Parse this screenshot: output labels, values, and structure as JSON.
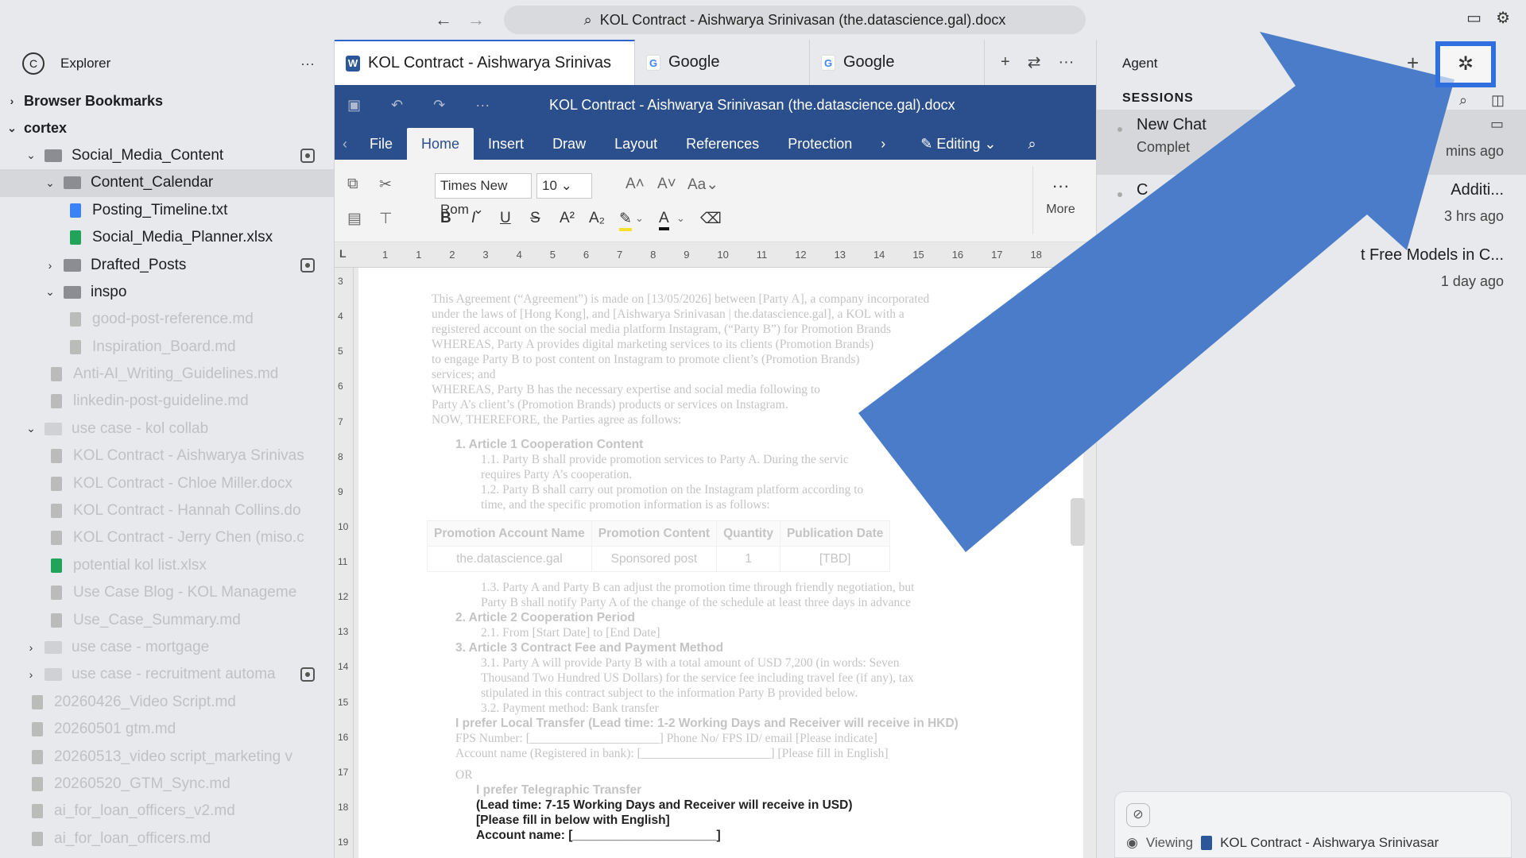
{
  "topbar": {
    "back": "←",
    "forward": "→",
    "url": "KOL Contract - Aishwarya Srinivasan (the.datascience.gal).docx",
    "icons": [
      "chat-plus-icon",
      "settings-icon"
    ]
  },
  "sidebar": {
    "title": "Explorer",
    "more": "···",
    "items": [
      {
        "label": "Browser Bookmarks",
        "level": 0,
        "chev": "›",
        "bold": true
      },
      {
        "label": "cortex",
        "level": 0,
        "chev": "⌄",
        "bold": true
      },
      {
        "label": "Social_Media_Content",
        "level": 1,
        "chev": "⌄",
        "folder": true,
        "badge": true
      },
      {
        "label": "Content_Calendar",
        "level": 2,
        "chev": "⌄",
        "folder": true,
        "selected": true
      },
      {
        "label": "Posting_Timeline.txt",
        "level": 3,
        "file": "txt"
      },
      {
        "label": "Social_Media_Planner.xlsx",
        "level": 3,
        "file": "xlsx"
      },
      {
        "label": "Drafted_Posts",
        "level": 2,
        "chev": "›",
        "folder": true,
        "badge": true
      },
      {
        "label": "inspo",
        "level": 2,
        "chev": "⌄",
        "folder": true
      },
      {
        "label": "good-post-reference.md",
        "level": 3,
        "file": "md",
        "faded": true
      },
      {
        "label": "Inspiration_Board.md",
        "level": 3,
        "file": "md",
        "faded": true
      },
      {
        "label": "Anti-AI_Writing_Guidelines.md",
        "level": 2,
        "file": "md",
        "faded": true
      },
      {
        "label": "linkedin-post-guideline.md",
        "level": 2,
        "file": "md",
        "faded": true
      },
      {
        "label": "use case - kol collab",
        "level": 1,
        "chev": "⌄",
        "folder": true,
        "faded": true
      },
      {
        "label": "KOL Contract - Aishwarya Srinivas",
        "level": 2,
        "file": "docx",
        "faded": true
      },
      {
        "label": "KOL Contract - Chloe Miller.docx",
        "level": 2,
        "file": "docx",
        "faded": true
      },
      {
        "label": "KOL Contract - Hannah Collins.do",
        "level": 2,
        "file": "docx",
        "faded": true
      },
      {
        "label": "KOL Contract - Jerry Chen (miso.c",
        "level": 2,
        "file": "docx",
        "faded": true
      },
      {
        "label": "potential kol list.xlsx",
        "level": 2,
        "file": "xlsx",
        "faded": true
      },
      {
        "label": "Use Case Blog - KOL Manageme",
        "level": 2,
        "file": "md",
        "faded": true
      },
      {
        "label": "Use_Case_Summary.md",
        "level": 2,
        "file": "md",
        "faded": true
      },
      {
        "label": "use case - mortgage",
        "level": 1,
        "chev": "›",
        "folder": true,
        "faded": true
      },
      {
        "label": "use case - recruitment automa",
        "level": 1,
        "chev": "›",
        "folder": true,
        "faded": true,
        "badge": true
      },
      {
        "label": "20260426_Video Script.md",
        "level": 1,
        "file": "md",
        "faded": true
      },
      {
        "label": "20260501 gtm.md",
        "level": 1,
        "file": "md",
        "faded": true
      },
      {
        "label": "20260513_video script_marketing v",
        "level": 1,
        "file": "md",
        "faded": true
      },
      {
        "label": "20260520_GTM_Sync.md",
        "level": 1,
        "file": "md",
        "faded": true
      },
      {
        "label": "ai_for_loan_officers_v2.md",
        "level": 1,
        "file": "md",
        "faded": true
      },
      {
        "label": "ai_for_loan_officers.md",
        "level": 1,
        "file": "md",
        "faded": true
      }
    ]
  },
  "editor": {
    "tabs": [
      {
        "label": "KOL Contract - Aishwarya Srinivas",
        "icon": "W",
        "active": true
      },
      {
        "label": "Google",
        "icon": "G"
      },
      {
        "label": "Google",
        "icon": "G"
      }
    ],
    "doc_title": "KOL Contract - Aishwarya Srinivasan (the.datascience.gal).docx",
    "ribbon_tabs": [
      "File",
      "Home",
      "Insert",
      "Draw",
      "Layout",
      "References",
      "Protection"
    ],
    "active_ribbon_tab": "Home",
    "editing_label": "Editing",
    "font_name": "Times New Rom",
    "font_size": "10",
    "more_label": "More",
    "ruler_h": [
      "1",
      "1",
      "2",
      "3",
      "4",
      "5",
      "6",
      "7",
      "8",
      "9",
      "10",
      "11",
      "12",
      "13",
      "14",
      "15",
      "16",
      "17",
      "18"
    ],
    "ruler_v": [
      "3",
      "4",
      "5",
      "6",
      "7",
      "8",
      "9",
      "10",
      "11",
      "12",
      "13",
      "14",
      "15",
      "16",
      "17",
      "18",
      "19"
    ],
    "doc": {
      "intro": [
        "This Agreement (“Agreement”) is made on [13/05/2026] between [Party A], a company incorporated",
        "under the laws of [Hong Kong], and [Aishwarya Srinivasan | the.datascience.gal], a KOL with a",
        "registered account on the social media platform Instagram, (“Party B”) for Promotion Brands",
        "WHEREAS, Party A provides digital marketing services to its clients (Promotion Brands)",
        "to engage Party B to post content on Instagram to promote client’s (Promotion Brands)",
        "services; and",
        "WHEREAS, Party B has the necessary expertise and social media following to",
        "Party A’s client’s (Promotion Brands) products or services on Instagram.",
        "NOW, THEREFORE, the Parties agree as follows:"
      ],
      "article1_heading": "1. Article 1 Cooperation Content",
      "article1_lines": [
        "1.1. Party B shall provide promotion services to Party A. During the servic",
        "requires Party A’s cooperation.",
        "1.2. Party B shall carry out promotion on the Instagram platform according to",
        "time, and the specific promotion information is as follows:"
      ],
      "table_headers": [
        "Promotion Account Name",
        "Promotion Content",
        "Quantity",
        "Publication Date"
      ],
      "table_row": [
        "the.datascience.gal",
        "Sponsored post",
        "1",
        "[TBD]"
      ],
      "article1_after": [
        "1.3. Party A and Party B can adjust the promotion time through friendly negotiation, but",
        "Party B shall notify Party A of the change of the schedule at least three days in advance"
      ],
      "article2_heading": "2. Article 2 Cooperation Period",
      "article2_lines": [
        "2.1. From [Start Date] to [End Date]"
      ],
      "article3_heading": "3. Article 3 Contract Fee and Payment Method",
      "article3_lines": [
        "3.1. Party A will provide Party B with a total amount of USD 7,200 (in words: Seven",
        "Thousand Two Hundred US Dollars) for the service fee including travel fee (if any), tax",
        "stipulated in this contract subject to the information Party B provided below.",
        "3.2. Payment method: Bank transfer"
      ],
      "local_transfer": "I prefer Local Transfer (Lead time: 1-2 Working Days and Receiver will receive in HKD)",
      "fps_line": "FPS Number: [_____________________] Phone No/ FPS ID/ email [Please indicate]",
      "account_line": "Account name (Registered in bank): [_____________________] [Please fill in English]",
      "or": "OR",
      "tele_transfer": "I prefer Telegraphic Transfer",
      "tele_lines": [
        "(Lead time: 7-15 Working Days and Receiver will receive in USD)",
        "[Please fill in below with English]",
        "Account name: [_____________________]"
      ]
    }
  },
  "agent": {
    "title": "Agent",
    "sessions_label": "SESSIONS",
    "sessions": [
      {
        "title": "New Chat",
        "subtitle": "Complet",
        "time": "mins ago",
        "selected": true
      },
      {
        "title": "C",
        "subtitle": "",
        "right_title": "Additi...",
        "time": "3 hrs ago"
      },
      {
        "title": "",
        "subtitle": "",
        "right_title": "t Free Models in C...",
        "time": "1 day ago"
      }
    ],
    "viewing_label": "Viewing",
    "viewing_doc": "KOL Contract - Aishwarya Srinivasar",
    "highlight_icon": "bug-icon"
  },
  "annotation": {
    "arrow_color": "#4a7cc9",
    "box_color": "#2f6fde"
  }
}
